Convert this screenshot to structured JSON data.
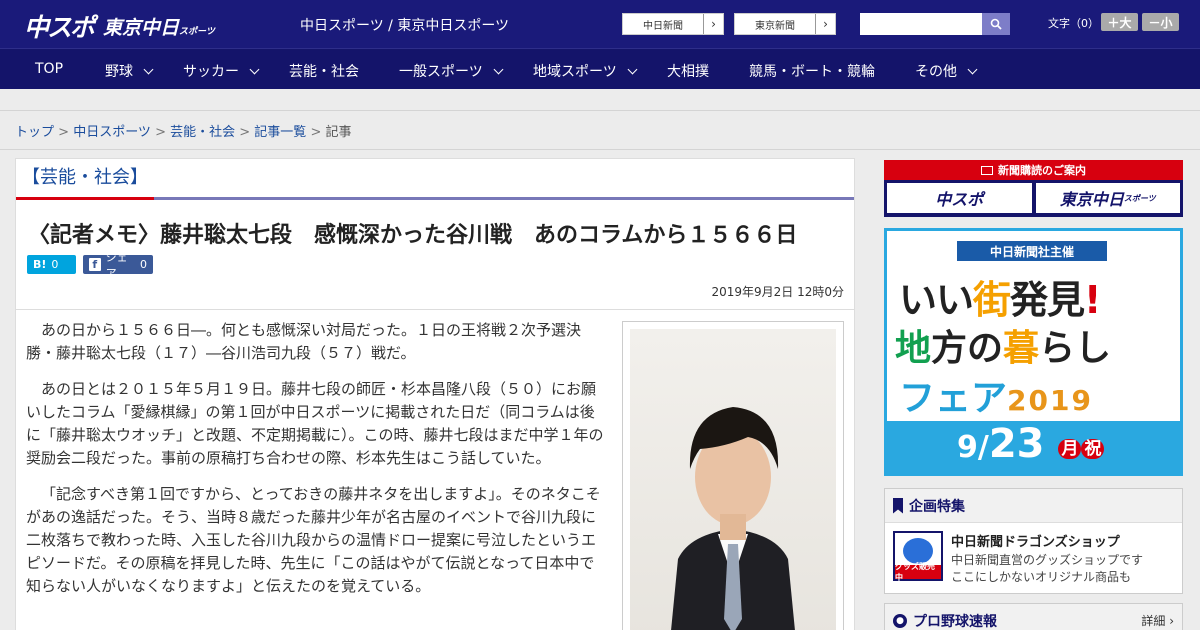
{
  "header": {
    "logo_primary": "中スポ",
    "logo_secondary": "東京中日",
    "logo_secondary_small": "スポーツ",
    "site_title": "中日スポーツ / 東京中日スポーツ",
    "link1": "中日新聞",
    "link2": "東京新聞",
    "search_placeholder": "",
    "font_size_label": "文字（0）",
    "font_larger": "＋大",
    "font_smaller": "－小"
  },
  "nav": [
    {
      "label": "TOP",
      "dropdown": false
    },
    {
      "label": "野球",
      "dropdown": true
    },
    {
      "label": "サッカー",
      "dropdown": true
    },
    {
      "label": "芸能・社会",
      "dropdown": false
    },
    {
      "label": "一般スポーツ",
      "dropdown": true
    },
    {
      "label": "地域スポーツ",
      "dropdown": true
    },
    {
      "label": "大相撲",
      "dropdown": false
    },
    {
      "label": "競馬・ボート・競輪",
      "dropdown": false
    },
    {
      "label": "その他",
      "dropdown": true
    }
  ],
  "breadcrumb": [
    {
      "label": "トップ",
      "link": true
    },
    {
      "label": "中日スポーツ",
      "link": true
    },
    {
      "label": "芸能・社会",
      "link": true
    },
    {
      "label": "記事一覧",
      "link": true
    },
    {
      "label": "記事",
      "link": false
    }
  ],
  "article": {
    "section": "【芸能・社会】",
    "headline": "〈記者メモ〉藤井聡太七段　感慨深かった谷川戦　あのコラムから１５６６日",
    "hatena_label": "B!",
    "hatena_count": "0",
    "fb_label": "シェア",
    "fb_count": "0",
    "date": "2019年9月2日 12時0分",
    "paragraphs": [
      "あの日から１５６６日―。何とも感慨深い対局だった。１日の王将戦２次予選決勝・藤井聡太七段（１７）―谷川浩司九段（５７）戦だ。",
      "あの日とは２０１５年５月１９日。藤井七段の師匠・杉本昌隆八段（５０）にお願いしたコラム「愛縁棋縁」の第１回が中日スポーツに掲載された日だ（同コラムは後に「藤井聡太ウオッチ」と改題、不定期掲載に）。この時、藤井七段はまだ中学１年の奨励会二段だった。事前の原稿打ち合わせの際、杉本先生はこう話していた。",
      "「記念すべき第１回ですから、とっておきの藤井ネタを出しますよ」。そのネタこそがあの逸話だった。そう、当時８歳だった藤井少年が名古屋のイベントで谷川九段に二枚落ちで教わった時、入玉した谷川九段からの温情ドロー提案に号泣したというエピソードだ。その原稿を拝見した時、先生に「この話はやがて伝説となって日本中で知らない人がいなくなりますよ」と伝えたのを覚えている。"
    ]
  },
  "sidebar": {
    "subscribe_title": "新聞購読のご案内",
    "subscribe_logo1": "中スポ",
    "subscribe_logo2": "東京中日",
    "subscribe_logo2_small": "スポーツ",
    "ad_banner": "中日新聞社主催",
    "ad_line1_a": "いい",
    "ad_line1_b": "街",
    "ad_line1_c": "発見",
    "ad_line1_d": "!",
    "ad_line2_a": "地",
    "ad_line2_b": "方の",
    "ad_line2_c": "暮",
    "ad_line2_d": "らし",
    "ad_line3_a": "フェア",
    "ad_line3_year": "2019",
    "ad_date_month": "9/",
    "ad_date_day": "23",
    "ad_date_weekday": "月",
    "ad_date_holiday": "祝",
    "feature_title": "企画特集",
    "shop_title": "中日新聞ドラゴンズショップ",
    "shop_desc1": "中日新聞直営のグッズショップです",
    "shop_desc2": "ここにしかないオリジナル商品も",
    "shop_badge": "グッズ販売中",
    "baseball_title": "プロ野球速報",
    "baseball_more": "詳細 ›"
  },
  "colors": {
    "header_bg": "#1a1a7a",
    "nav_bg": "#14146a",
    "accent_red": "#d7000f",
    "link_blue": "#1a4c9c"
  }
}
